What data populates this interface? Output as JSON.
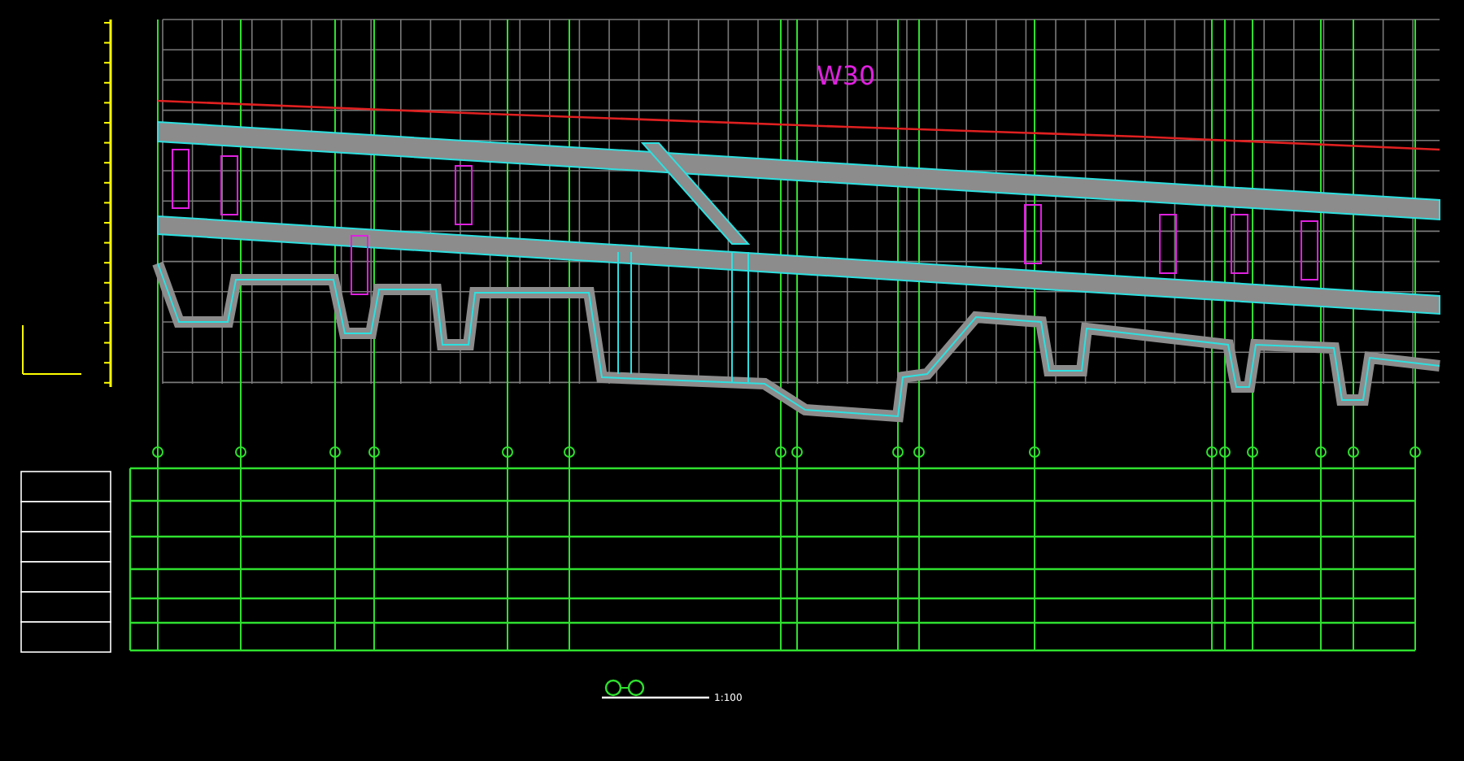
{
  "profile": {
    "label": "W30"
  },
  "title_block": {
    "scale": "1:100"
  }
}
